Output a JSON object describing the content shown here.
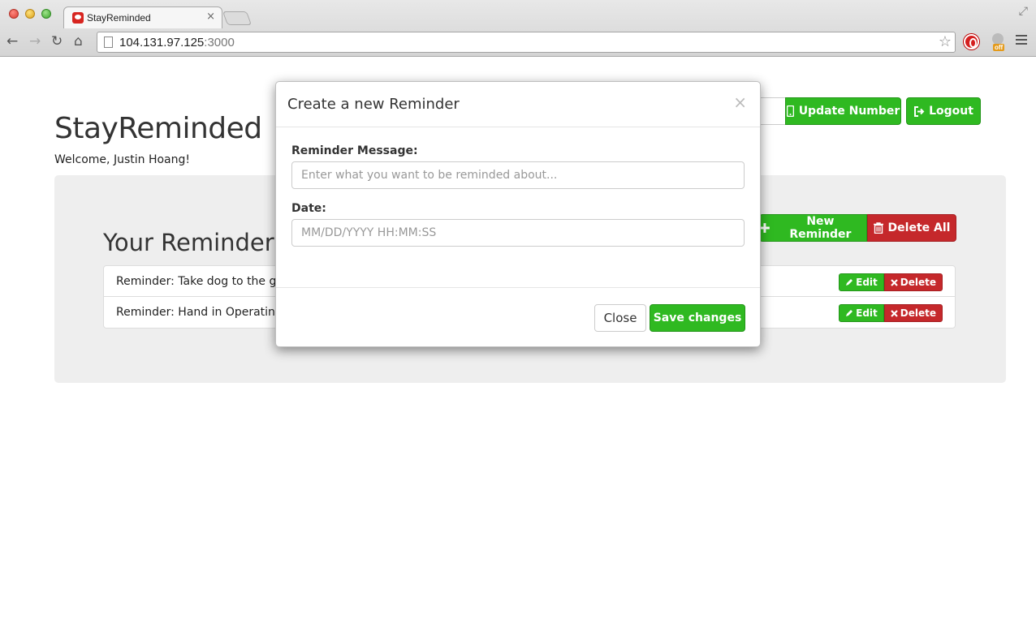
{
  "browser": {
    "tab_title": "StayReminded",
    "tab_close": "×",
    "url_host": "104.131.97.125",
    "url_port": ":3000",
    "extension_badge": "off"
  },
  "header": {
    "brand": "StayReminded",
    "welcome": "Welcome, Justin Hoang!",
    "update_number_label": "Update Number",
    "logout_label": "Logout"
  },
  "reminders": {
    "title": "Your Reminders",
    "new_label": "New Reminder",
    "delete_all_label": "Delete All",
    "items": [
      {
        "text": "Reminder: Take dog to the g",
        "edit": "Edit",
        "delete": "Delete"
      },
      {
        "text": "Reminder: Hand in Operating",
        "edit": "Edit",
        "delete": "Delete"
      }
    ]
  },
  "modal": {
    "title": "Create a new Reminder",
    "close_icon": "×",
    "message_label": "Reminder Message:",
    "message_placeholder": "Enter what you want to be reminded about...",
    "date_label": "Date:",
    "date_placeholder": "MM/DD/YYYY HH:MM:SS",
    "close_button": "Close",
    "save_button": "Save changes"
  },
  "colors": {
    "success": "#2fb921",
    "danger": "#c5282b",
    "jumbotron": "#eeeeee"
  }
}
